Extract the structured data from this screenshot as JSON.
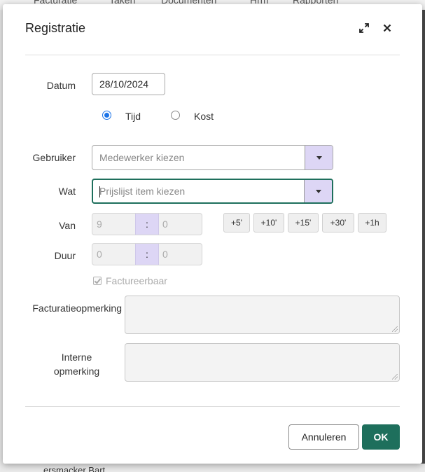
{
  "background": {
    "nav_items": [
      "Facturatie",
      "Taken",
      "Documenten",
      "Hrm",
      "Rapporten"
    ],
    "bottom_text": "ersmacker Bart"
  },
  "dialog": {
    "title": "Registratie",
    "expand_icon": "expand-icon",
    "close_icon": "close-icon"
  },
  "form": {
    "datum_label": "Datum",
    "datum_value": "28/10/2024",
    "type_options": [
      {
        "label": "Tijd",
        "checked": true
      },
      {
        "label": "Kost",
        "checked": false
      }
    ],
    "gebruiker_label": "Gebruiker",
    "gebruiker_placeholder": "Medewerker kiezen",
    "wat_label": "Wat",
    "wat_placeholder": "Prijslijst item kiezen",
    "van_label": "Van",
    "van_hours": "9",
    "van_minutes": "0",
    "time_separator": ":",
    "increments": [
      "+5'",
      "+10'",
      "+15'",
      "+30'",
      "+1h"
    ],
    "duur_label": "Duur",
    "duur_hours": "0",
    "duur_minutes": "0",
    "factureerbaar_label": "Factureerbaar",
    "facturatieopmerking_label": "Facturatieopmerking",
    "interne_label_line1": "Interne",
    "interne_label_line2": "opmerking"
  },
  "footer": {
    "cancel_label": "Annuleren",
    "ok_label": "OK"
  },
  "colors": {
    "primary": "#1e6f5c",
    "accent_light": "#ddd6f5",
    "radio": "#1a73e8"
  }
}
